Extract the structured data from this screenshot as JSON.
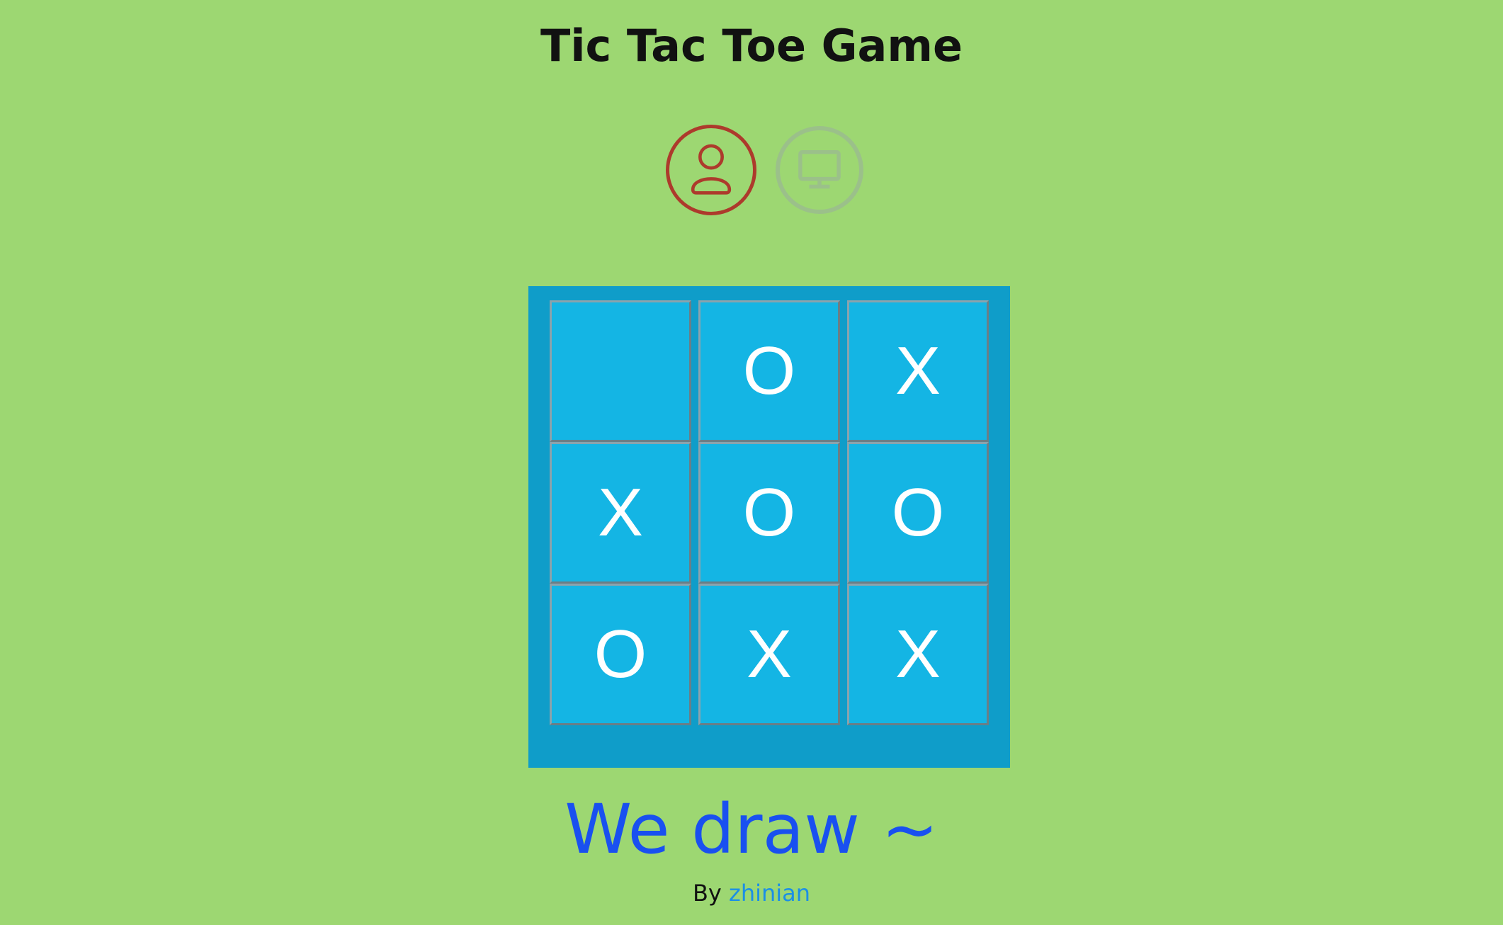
{
  "header": {
    "title": "Tic Tac Toe Game"
  },
  "players": {
    "human": {
      "icon": "person-icon",
      "color": "#ad3a2c",
      "active": true
    },
    "computer": {
      "icon": "monitor-icon",
      "color": "#9bc08a",
      "active": false
    }
  },
  "board": {
    "cells": [
      "",
      "O",
      "X",
      "X",
      "O",
      "O",
      "O",
      "X",
      "X"
    ]
  },
  "status": {
    "message": "We draw ~"
  },
  "footer": {
    "by_label": "By",
    "author": "zhinian"
  },
  "colors": {
    "background": "#9dd772",
    "board_frame": "#0f9dc9",
    "cell": "#14b5e4",
    "status_text": "#1950f0",
    "link": "#1b8fe6"
  }
}
